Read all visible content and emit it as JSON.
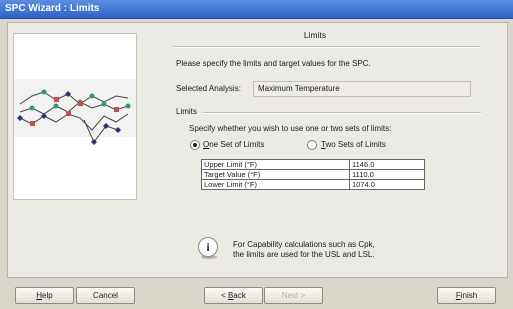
{
  "window": {
    "title": "SPC Wizard : Limits"
  },
  "header": {
    "title": "Limits"
  },
  "intro": "Please specify the limits and target values for the SPC.",
  "analysis": {
    "label": "Selected Analysis:",
    "value": "Maximum Temperature"
  },
  "limits_group": {
    "label": "Limits",
    "prompt": "Specify whether you wish to use one or two sets of limits:",
    "options": [
      {
        "label": "One Set of Limits",
        "selected": true
      },
      {
        "label": "Two Sets of Limits",
        "selected": false
      }
    ],
    "rows": [
      {
        "name": "Upper Limit (°F)",
        "value": "1146.0"
      },
      {
        "name": "Target Value (°F)",
        "value": "1110.0"
      },
      {
        "name": "Lower Limit (°F)",
        "value": "1074.0"
      }
    ]
  },
  "info": {
    "icon": "info-icon",
    "line1": "For Capability calculations such as Cpk,",
    "line2": "the limits are used for the USL and LSL."
  },
  "buttons": {
    "help": "Help",
    "cancel": "Cancel",
    "back": "< Back",
    "next": "Next >",
    "finish": "Finish"
  },
  "colors": {
    "titlebar": "#2f63c4",
    "marker_green": "#2e9c5c",
    "marker_red": "#c0504d",
    "marker_navy": "#2a2f7a"
  }
}
